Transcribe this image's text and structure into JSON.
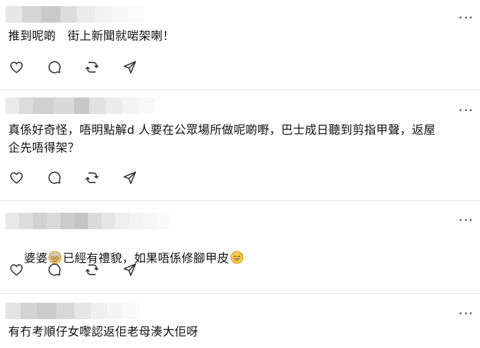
{
  "posts": [
    {
      "text": "推到呢啲　街上新聞就啱架喇！",
      "username": "",
      "emojis": []
    },
    {
      "text": "真係好奇怪，唔明點解d 人要在公眾場所做呢啲嘢，巴士成日聽到剪指甲聲，返屋\n企先唔得架？",
      "username": "",
      "emojis": []
    },
    {
      "text_parts": [
        "婆婆",
        "已經有禮貌，如果唔係修腳甲皮",
        ""
      ],
      "emojis": [
        "old-woman-emoji",
        "grinning-sweat-emoji"
      ]
    },
    {
      "text": "有冇考順仔女嚟認返佢老母湊大佢呀",
      "username": "",
      "emojis": []
    }
  ],
  "actions": [
    "heart-icon",
    "comment-icon",
    "repost-icon",
    "share-icon"
  ],
  "colors": {
    "text": "#111111",
    "divider": "#e6e6e6",
    "icon": "#333333",
    "blur": "#d9d9d9"
  }
}
